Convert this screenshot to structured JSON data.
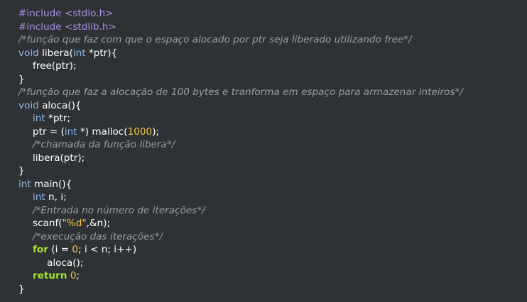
{
  "code_editor": {
    "lines": [
      {
        "indent": 0,
        "tokens": [
          {
            "t": "#include <stdio.h>",
            "k": "prep"
          }
        ]
      },
      {
        "indent": 0,
        "tokens": [
          {
            "t": "#include <stdlib.h>",
            "k": "prep"
          }
        ]
      },
      {
        "indent": 0,
        "tokens": [
          {
            "t": "/*função que faz com que o espaço alocado por ptr seja liberado utilizando free*/",
            "k": "comment"
          }
        ]
      },
      {
        "indent": 0,
        "tokens": [
          {
            "t": "void",
            "k": "type"
          },
          {
            "t": " libera(",
            "k": "plain"
          },
          {
            "t": "int",
            "k": "type"
          },
          {
            "t": " *ptr){",
            "k": "plain"
          }
        ]
      },
      {
        "indent": 1,
        "tokens": [
          {
            "t": "free(ptr);",
            "k": "plain"
          }
        ]
      },
      {
        "indent": 0,
        "tokens": [
          {
            "t": "}",
            "k": "plain"
          }
        ]
      },
      {
        "indent": 0,
        "tokens": [
          {
            "t": "/*função que faz a alocação de 100 bytes e tranforma em espaço para armazenar inteiros*/",
            "k": "comment"
          }
        ]
      },
      {
        "indent": 0,
        "tokens": [
          {
            "t": "void",
            "k": "type"
          },
          {
            "t": " aloca(){",
            "k": "plain"
          }
        ]
      },
      {
        "indent": 1,
        "tokens": [
          {
            "t": "int",
            "k": "type"
          },
          {
            "t": " *ptr;",
            "k": "plain"
          }
        ]
      },
      {
        "indent": 1,
        "tokens": [
          {
            "t": "ptr = (",
            "k": "plain"
          },
          {
            "t": "int",
            "k": "type"
          },
          {
            "t": " *) malloc(",
            "k": "plain"
          },
          {
            "t": "1000",
            "k": "num"
          },
          {
            "t": ");",
            "k": "plain"
          }
        ]
      },
      {
        "indent": 1,
        "tokens": [
          {
            "t": "/*chamada da função libera*/",
            "k": "comment"
          }
        ]
      },
      {
        "indent": 1,
        "tokens": [
          {
            "t": "libera(ptr);",
            "k": "plain"
          }
        ]
      },
      {
        "indent": 0,
        "tokens": [
          {
            "t": "}",
            "k": "plain"
          }
        ]
      },
      {
        "indent": 0,
        "tokens": [
          {
            "t": "int",
            "k": "type"
          },
          {
            "t": " main(){",
            "k": "plain"
          }
        ]
      },
      {
        "indent": 1,
        "tokens": [
          {
            "t": "int",
            "k": "type"
          },
          {
            "t": " n, i;",
            "k": "plain"
          }
        ]
      },
      {
        "indent": 1,
        "tokens": [
          {
            "t": "/*Entrada no número de iterações*/",
            "k": "comment"
          }
        ]
      },
      {
        "indent": 1,
        "tokens": [
          {
            "t": "scanf(",
            "k": "plain"
          },
          {
            "t": "\"%d\"",
            "k": "str"
          },
          {
            "t": ",&n);",
            "k": "plain"
          }
        ]
      },
      {
        "indent": 1,
        "tokens": [
          {
            "t": "/*execução das iterações*/",
            "k": "comment"
          }
        ]
      },
      {
        "indent": 1,
        "tokens": [
          {
            "t": "for",
            "k": "kw"
          },
          {
            "t": " (i = ",
            "k": "plain"
          },
          {
            "t": "0",
            "k": "num"
          },
          {
            "t": "; i < n; i++)",
            "k": "plain"
          }
        ]
      },
      {
        "indent": 2,
        "tokens": [
          {
            "t": "aloca();",
            "k": "plain"
          }
        ]
      },
      {
        "indent": 1,
        "tokens": [
          {
            "t": "return",
            "k": "kw"
          },
          {
            "t": " ",
            "k": "plain"
          },
          {
            "t": "0",
            "k": "num"
          },
          {
            "t": ";",
            "k": "plain"
          }
        ]
      },
      {
        "indent": 0,
        "tokens": [
          {
            "t": "}",
            "k": "plain"
          }
        ]
      }
    ]
  },
  "colors": {
    "background": "#2f3235",
    "preprocessor": "#a78fe0",
    "comment": "#93a1a1",
    "type": "#8fb6e8",
    "keyword": "#a6e22e",
    "number": "#f4c542",
    "text": "#ffffff"
  }
}
